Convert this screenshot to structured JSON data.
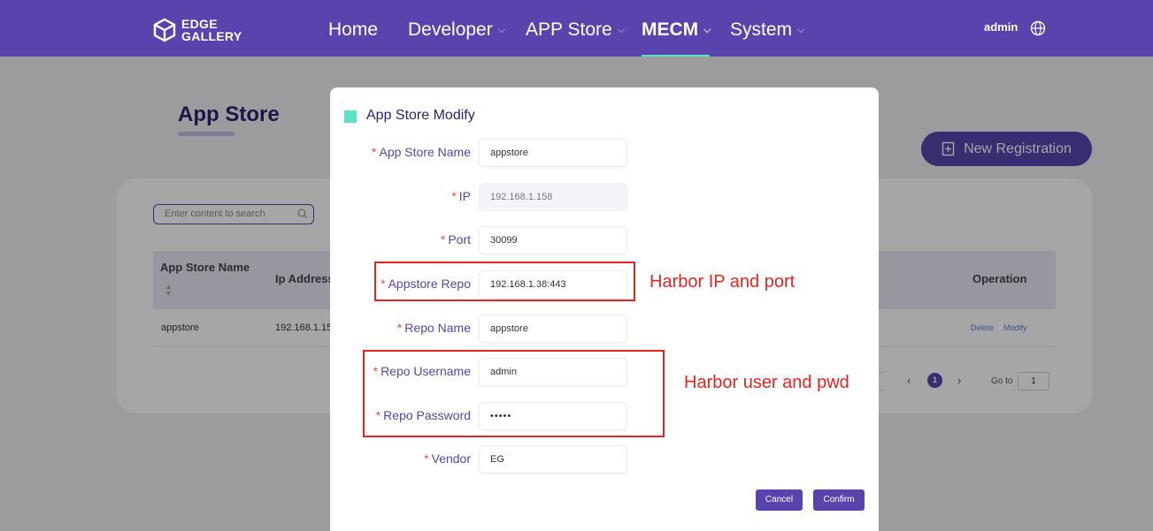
{
  "brand": {
    "line1": "EDGE",
    "line2": "GALLERY"
  },
  "nav": {
    "items": [
      {
        "label": "Home",
        "has_menu": false
      },
      {
        "label": "Developer",
        "has_menu": true
      },
      {
        "label": "APP Store",
        "has_menu": true
      },
      {
        "label": "MECM",
        "has_menu": true,
        "active": true
      },
      {
        "label": "System",
        "has_menu": true
      }
    ],
    "user": "admin"
  },
  "page": {
    "title": "App Store",
    "new_registration": "New Registration",
    "search_placeholder": "Enter content to search",
    "table": {
      "headers": {
        "name": "App Store Name",
        "ip": "Ip Address",
        "operation": "Operation"
      },
      "rows": [
        {
          "name": "appstore",
          "ip": "192.168.1.15",
          "actions": [
            "Delete",
            "Modify"
          ]
        }
      ]
    },
    "pager": {
      "prev": "‹",
      "current": "1",
      "next": "›",
      "goto_label": "Go to",
      "goto_value": "1"
    }
  },
  "dialog": {
    "title": "App Store Modify",
    "fields": {
      "app_store_name": {
        "label": "App Store Name",
        "value": "appstore"
      },
      "ip": {
        "label": "IP",
        "value": "192.168.1.158",
        "disabled": true
      },
      "port": {
        "label": "Port",
        "value": "30099"
      },
      "appstore_repo": {
        "label": "Appstore Repo",
        "value": "192.168.1.38:443"
      },
      "repo_name": {
        "label": "Repo Name",
        "value": "appstore"
      },
      "repo_username": {
        "label": "Repo Username",
        "value": "admin"
      },
      "repo_password": {
        "label": "Repo Password",
        "value": "•••••"
      },
      "vendor": {
        "label": "Vendor",
        "value": "EG"
      }
    },
    "required_mark": "*",
    "cancel": "Cancel",
    "confirm": "Confirm"
  },
  "annotations": {
    "harbor_ip_port": "Harbor IP and port",
    "harbor_user_pwd": "Harbor user and pwd"
  },
  "colors": {
    "primary": "#5944ae",
    "accent": "#5de2c8",
    "annotation": "#e8231e",
    "required": "#e0524f"
  }
}
